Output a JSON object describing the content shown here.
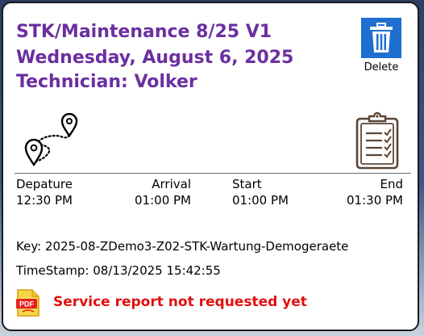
{
  "header": {
    "title": "STK/Maintenance 8/25 V1",
    "date": "Wednesday, August 6, 2025",
    "technician": "Technician: Volker",
    "title_color": "#6b2fa0"
  },
  "actions": {
    "delete_label": "Delete",
    "delete_icon": "trash-bin-icon",
    "delete_color": "#1e6fd0"
  },
  "icons": {
    "route": "route-map-pin-icon",
    "report": "clipboard-checklist-icon",
    "pdf": "pdf-file-icon"
  },
  "times": {
    "departure_label": "Depature",
    "departure_value": "12:30 PM",
    "arrival_label": "Arrival",
    "arrival_value": "01:00 PM",
    "start_label": "Start",
    "start_value": "01:00 PM",
    "end_label": "End",
    "end_value": "01:30 PM"
  },
  "info": {
    "key": "Key: 2025-08-ZDemo3-Z02-STK-Wartung-Demogeraete",
    "timestamp": "TimeStamp: 08/13/2025 15:42:55"
  },
  "report": {
    "status": "Service report not requested yet",
    "status_color": "#e01010"
  }
}
